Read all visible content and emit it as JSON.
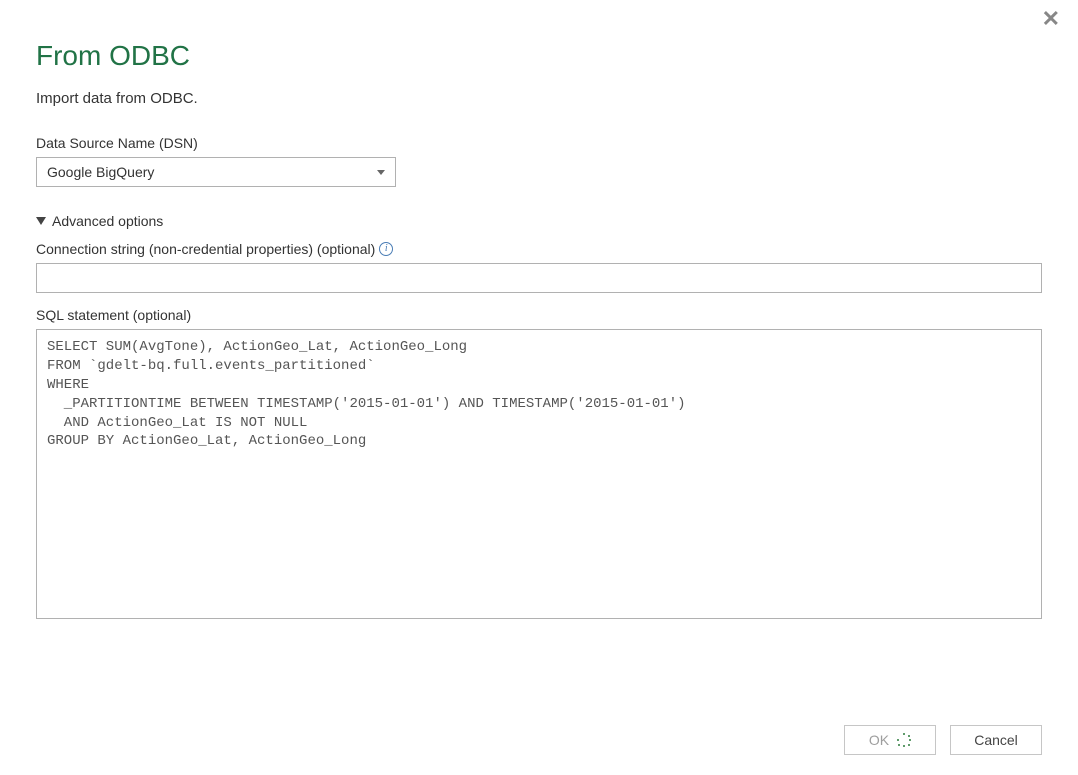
{
  "dialog": {
    "title": "From ODBC",
    "subtitle": "Import data from ODBC.",
    "dsn_label": "Data Source Name (DSN)",
    "dsn_value": "Google BigQuery",
    "advanced_label": "Advanced options",
    "conn_label": "Connection string (non-credential properties) (optional)",
    "conn_value": "",
    "sql_label": "SQL statement (optional)",
    "sql_value": "SELECT SUM(AvgTone), ActionGeo_Lat, ActionGeo_Long\nFROM `gdelt-bq.full.events_partitioned`\nWHERE\n  _PARTITIONTIME BETWEEN TIMESTAMP('2015-01-01') AND TIMESTAMP('2015-01-01')\n  AND ActionGeo_Lat IS NOT NULL\nGROUP BY ActionGeo_Lat, ActionGeo_Long",
    "ok_label": "OK",
    "cancel_label": "Cancel"
  }
}
